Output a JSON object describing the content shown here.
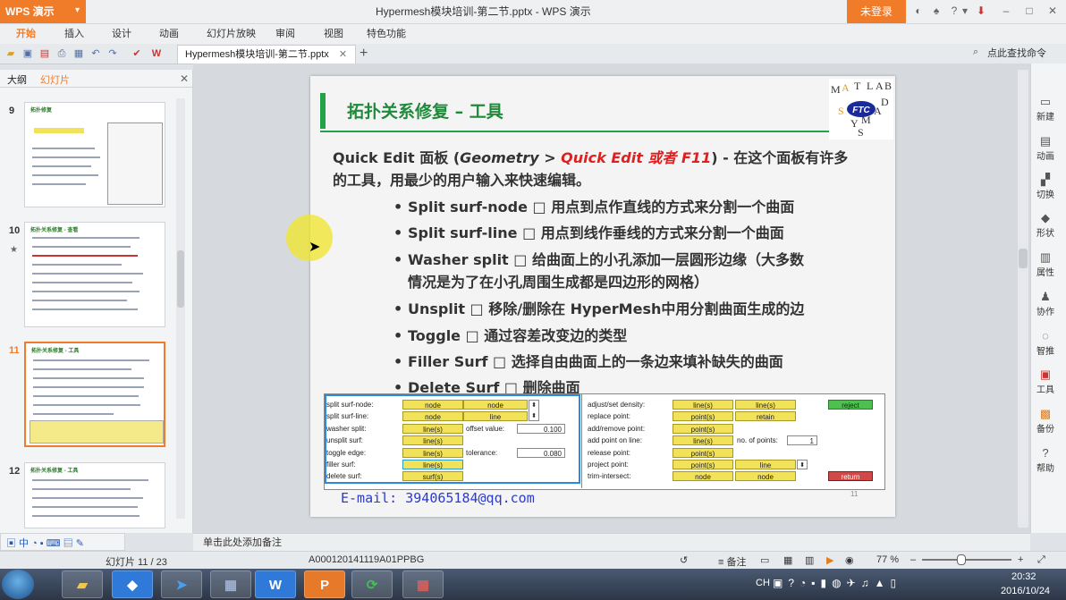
{
  "titlebar": {
    "app_name": "WPS 演示",
    "doc_title": "Hypermesh模块培训-第二节.pptx - WPS 演示",
    "login": "未登录"
  },
  "menus": [
    "开始",
    "插入",
    "设计",
    "动画",
    "幻灯片放映",
    "审阅",
    "视图",
    "特色功能"
  ],
  "doc_tab": "Hypermesh模块培训-第二节.pptx",
  "search_command": "点此查找命令",
  "left_panel": {
    "tabs": [
      "大纲",
      "幻灯片"
    ],
    "thumbs": [
      {
        "num": "9",
        "title": "拓扑修复"
      },
      {
        "num": "10",
        "title": "拓扑关系修复 - 查看"
      },
      {
        "num": "11",
        "title": "拓扑关系修复 - 工具"
      },
      {
        "num": "12",
        "title": "拓扑关系修复 - 工具"
      }
    ]
  },
  "slide": {
    "title": "拓扑关系修复 – 工具",
    "logo_letters": "MATLAB FTC SYMS",
    "logo_center": "FTC",
    "intro_prefix": "Quick Edit 面板 (",
    "intro_geom": "Geometry",
    "intro_gt": " > ",
    "intro_red": "Quick Edit 或者 F11",
    "intro_suffix": ") - 在这个面板有许多",
    "intro_line2": "的工具，用最少的用户输入来快速编辑。",
    "bullets": [
      {
        "text": "Split surf-node □  用点到点作直线的方式来分割一个曲面"
      },
      {
        "text": "Split surf-line □  用点到线作垂线的方式来分割一个曲面"
      },
      {
        "text": "Washer split □  给曲面上的小孔添加一层圆形边缘（大多数"
      },
      {
        "text": "情况是为了在小孔周围生成都是四边形的网格）"
      },
      {
        "text": "Unsplit □  移除/删除在 HyperMesh中用分割曲面生成的边"
      },
      {
        "text": "Toggle □  通过容差改变边的类型"
      },
      {
        "text": "Filler Surf □  选择自由曲面上的一条边来填补缺失的曲面"
      },
      {
        "text": "Delete Surf □  删除曲面"
      }
    ],
    "email": "E-mail: 394065184@qq.com",
    "page": "11"
  },
  "panel": {
    "left_labels": [
      "split surf-node:",
      "split surf-line:",
      "washer split:",
      "unsplit surf:",
      "toggle edge:",
      "filler surf:",
      "delete surf:"
    ],
    "col1": [
      "node",
      "node",
      "line(s)",
      "line(s)",
      "line(s)",
      "line(s)",
      "surf(s)"
    ],
    "col2": [
      "node",
      "line"
    ],
    "offset_label": "offset value:",
    "offset_value": "0.100",
    "tolerance_label": "tolerance:",
    "tolerance_value": "0.080",
    "right_labels": [
      "adjust/set density:",
      "replace point:",
      "add/remove point:",
      "add point on line:",
      "release point:",
      "project point:",
      "trim-intersect:"
    ],
    "rcol1": [
      "line(s)",
      "point(s)",
      "point(s)",
      "line(s)",
      "point(s)",
      "point(s)",
      "node"
    ],
    "rcol2": [
      "line(s)",
      "retain",
      "",
      "",
      "",
      "line",
      "node"
    ],
    "points_label": "no. of points:",
    "points_value": "1",
    "reject": "reject",
    "return": "return"
  },
  "right_bar": [
    "新建",
    "动画",
    "切换",
    "形状",
    "属性",
    "协作",
    "智推",
    "工具",
    "备份",
    "帮助"
  ],
  "notes": "单击此处添加备注",
  "status": {
    "slide_counter": "幻灯片 11 / 23",
    "template_id": "A000120141119A01PPBG",
    "notes_label": "备注",
    "zoom": "77 %"
  },
  "taskbar": {
    "lang": "CH",
    "time": "20:32",
    "date": "2016/10/24"
  }
}
